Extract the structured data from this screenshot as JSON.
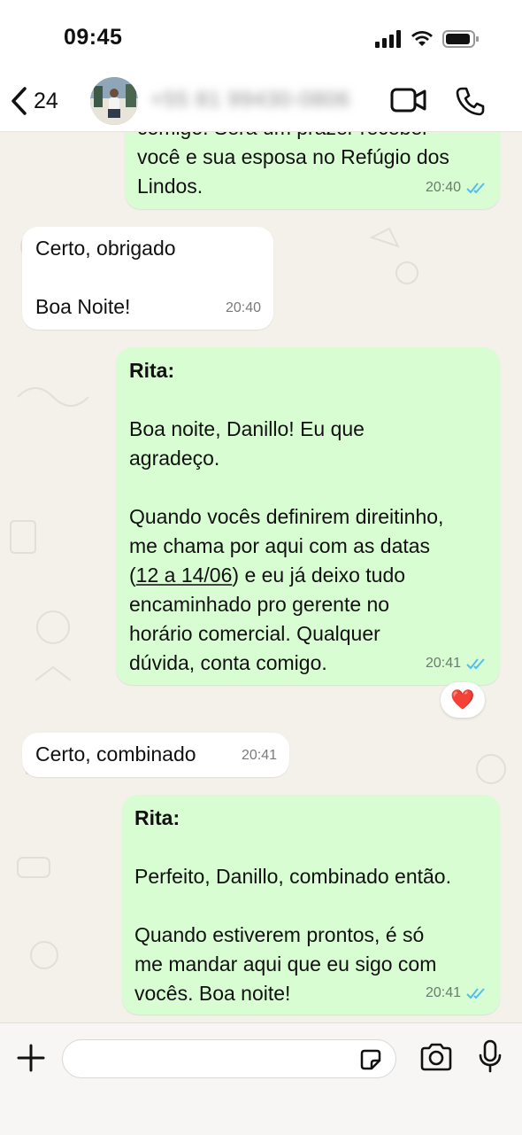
{
  "status_bar": {
    "time": "09:45"
  },
  "header": {
    "back_count": "24",
    "contact_name": "+55 81 99430-0806"
  },
  "messages": [
    {
      "direction": "out",
      "text": "comigo. Será um prazer receber\nvocê e sua esposa no Refúgio dos\nLindos.",
      "time": "20:40"
    },
    {
      "direction": "in",
      "text": "Certo, obrigado\n\nBoa Noite!",
      "time": "20:40"
    },
    {
      "direction": "out",
      "sender": "Rita:",
      "text_part1": "Boa noite, Danillo! Eu que\nagradeço.\n\nQuando vocês definirem direitinho,\nme chama por aqui com as datas\n(",
      "text_link": "12 a 14/06",
      "text_part2": ") e eu já deixo tudo\nencaminhado pro gerente no\nhorário comercial. Qualquer\ndúvida, conta comigo.",
      "time": "20:41",
      "reaction": "❤️"
    },
    {
      "direction": "in",
      "text": "Certo, combinado",
      "time": "20:41"
    },
    {
      "direction": "out",
      "sender": "Rita:",
      "text": "Perfeito, Danillo, combinado então.\n\nQuando estiverem prontos, é só\nme mandar aqui que eu sigo com\nvocês. Boa noite!",
      "time": "20:41"
    }
  ],
  "composer": {
    "value": "",
    "placeholder": ""
  },
  "colors": {
    "outgoing_bubble": "#d9fdd3",
    "incoming_bubble": "#ffffff",
    "read_ticks": "#53bdeb",
    "background": "#f4f0ea"
  },
  "icons": [
    "back-chevron-icon",
    "video-call-icon",
    "voice-call-icon",
    "double-check-icon",
    "plus-icon",
    "sticker-icon",
    "camera-icon",
    "microphone-icon"
  ]
}
